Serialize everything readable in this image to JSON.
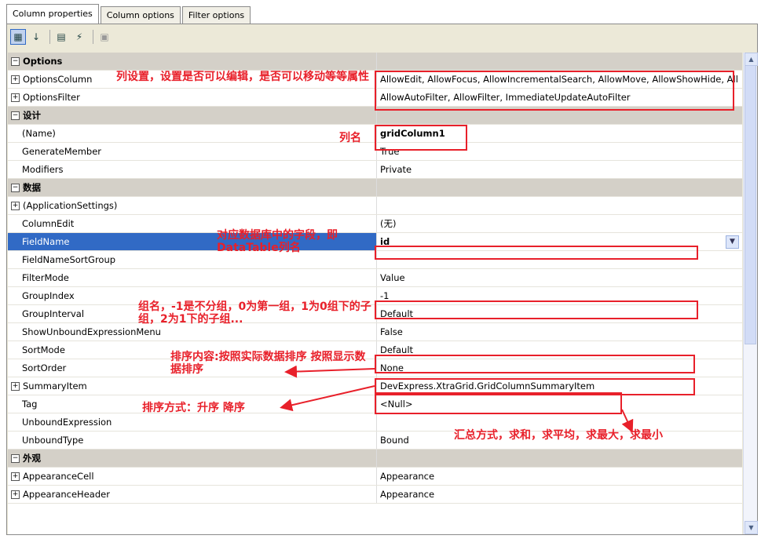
{
  "tabs": [
    "Column properties",
    "Column options",
    "Filter options"
  ],
  "toolbar": {
    "icons": [
      "categorized-icon",
      "alphabetical-icon",
      "properties-icon",
      "events-icon",
      "property-pages-icon"
    ]
  },
  "rows": [
    {
      "kind": "cat",
      "label": "Options"
    },
    {
      "kind": "item",
      "expand": true,
      "label": "OptionsColumn",
      "value": "AllowEdit, AllowFocus, AllowIncrementalSearch, AllowMove, AllowShowHide, All"
    },
    {
      "kind": "item",
      "expand": true,
      "label": "OptionsFilter",
      "value": "AllowAutoFilter, AllowFilter, ImmediateUpdateAutoFilter"
    },
    {
      "kind": "cat",
      "label": "设计"
    },
    {
      "kind": "item",
      "label": "(Name)",
      "value": "gridColumn1",
      "bold": true
    },
    {
      "kind": "item",
      "label": "GenerateMember",
      "value": "True"
    },
    {
      "kind": "item",
      "label": "Modifiers",
      "value": "Private"
    },
    {
      "kind": "cat",
      "label": "数据"
    },
    {
      "kind": "item",
      "expand": true,
      "label": "(ApplicationSettings)",
      "value": ""
    },
    {
      "kind": "item",
      "label": "ColumnEdit",
      "value": "(无)"
    },
    {
      "kind": "item",
      "label": "FieldName",
      "value": "id",
      "bold": true,
      "selected": true
    },
    {
      "kind": "item",
      "label": "FieldNameSortGroup",
      "value": ""
    },
    {
      "kind": "item",
      "label": "FilterMode",
      "value": "Value"
    },
    {
      "kind": "item",
      "label": "GroupIndex",
      "value": "-1"
    },
    {
      "kind": "item",
      "label": "GroupInterval",
      "value": "Default"
    },
    {
      "kind": "item",
      "label": "ShowUnboundExpressionMenu",
      "value": "False"
    },
    {
      "kind": "item",
      "label": "SortMode",
      "value": "Default"
    },
    {
      "kind": "item",
      "label": "SortOrder",
      "value": "None"
    },
    {
      "kind": "item",
      "expand": true,
      "label": "SummaryItem",
      "value": "DevExpress.XtraGrid.GridColumnSummaryItem"
    },
    {
      "kind": "item",
      "label": "Tag",
      "value": "<Null>"
    },
    {
      "kind": "item",
      "label": "UnboundExpression",
      "value": ""
    },
    {
      "kind": "item",
      "label": "UnboundType",
      "value": "Bound"
    },
    {
      "kind": "cat",
      "label": "外观"
    },
    {
      "kind": "item",
      "expand": true,
      "label": "AppearanceCell",
      "value": "Appearance"
    },
    {
      "kind": "item",
      "expand": true,
      "label": "AppearanceHeader",
      "value": "Appearance"
    }
  ],
  "annotations": {
    "options_column": "列设置，设置是否可以编辑，是否可以移动等等属性",
    "column_name": "列名",
    "field_name": "对应数据库中的字段，即DataTable列名",
    "group_index": "组名，-1是不分组，0为第一组，1为0组下的子组，2为1下的子组...",
    "sort_mode": "排序内容:按照实际数据排序 按照显示数据排序",
    "sort_order": "排序方式：升序 降序",
    "summary": "汇总方式，求和，求平均，求最大，求最小"
  },
  "colors": {
    "annotation": "#e8202a",
    "selection": "#316ac5",
    "category": "#d4d0c8"
  }
}
